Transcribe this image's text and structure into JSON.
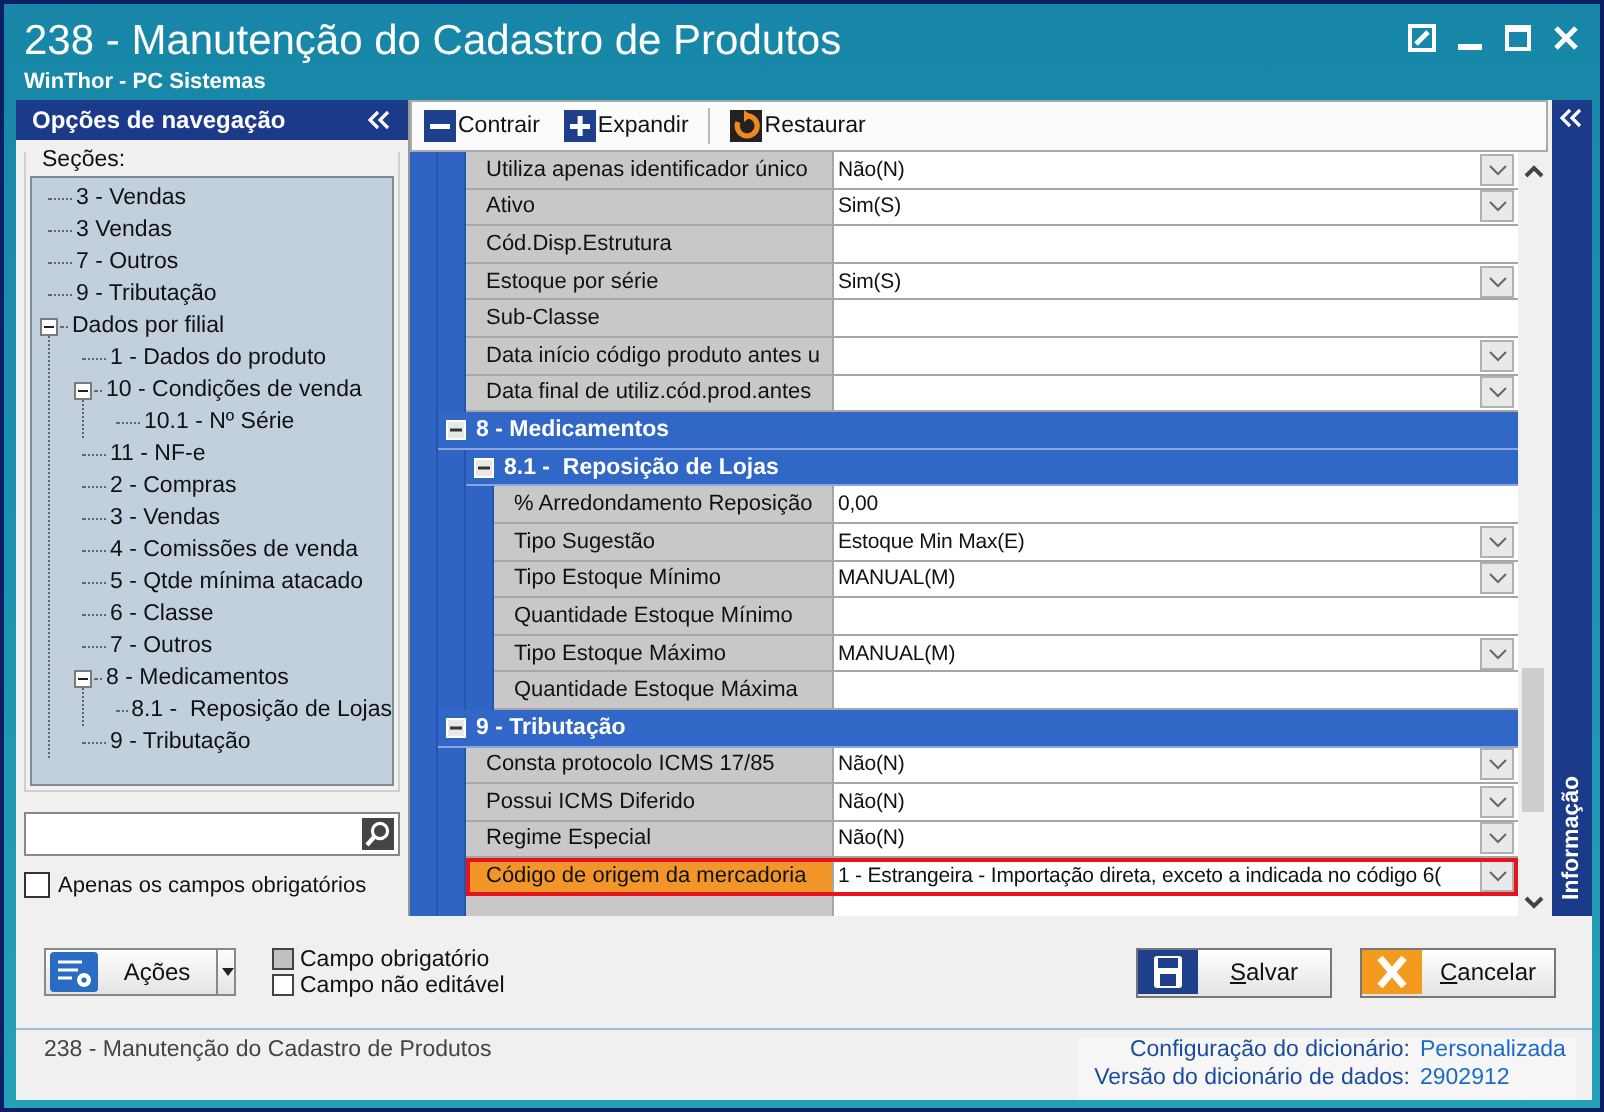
{
  "window": {
    "title": "238 - Manutenção do Cadastro de Produtos",
    "subtitle": "WinThor - PC Sistemas"
  },
  "navigation": {
    "title": "Opções de navegação",
    "sections_label": "Seções:",
    "tree": [
      {
        "label": "3 - Vendas"
      },
      {
        "label": "3 Vendas"
      },
      {
        "label": "7 - Outros"
      },
      {
        "label": "9 - Tributação"
      },
      {
        "label": "Dados por filial",
        "expanded": true,
        "children": [
          {
            "label": "1 - Dados do produto"
          },
          {
            "label": "10 - Condições de venda",
            "expanded": true,
            "children": [
              {
                "label": "10.1 - Nº Série"
              }
            ]
          },
          {
            "label": "11 - NF-e"
          },
          {
            "label": "2 - Compras"
          },
          {
            "label": "3 - Vendas"
          },
          {
            "label": "4 - Comissões de venda"
          },
          {
            "label": "5 - Qtde mínima atacado"
          },
          {
            "label": "6 - Classe"
          },
          {
            "label": "7 - Outros"
          },
          {
            "label": "8 - Medicamentos",
            "expanded": true,
            "children": [
              {
                "label": "8.1 -  Reposição de Lojas"
              }
            ]
          },
          {
            "label": "9 - Tributação"
          }
        ]
      }
    ],
    "only_required": {
      "label": "Apenas os campos obrigatórios",
      "checked": false
    }
  },
  "toolbar": [
    {
      "kind": "collapse",
      "label": "Contrair"
    },
    {
      "kind": "expand",
      "label": "Expandir"
    },
    {
      "kind": "restore",
      "label": "Restaurar"
    }
  ],
  "grid": {
    "items": [
      {
        "kind": "group",
        "children": [
          {
            "kind": "property",
            "label": "Utiliza apenas identificador único",
            "value": "Não(N)",
            "dropdown": true,
            "selected": false
          },
          {
            "kind": "property",
            "label": "Ativo",
            "value": "Sim(S)",
            "dropdown": true,
            "selected": false
          },
          {
            "kind": "property",
            "label": "Cód.Disp.Estrutura",
            "dropdown": false,
            "selected": false
          },
          {
            "kind": "property",
            "label": "Estoque por série",
            "value": "Sim(S)",
            "dropdown": true,
            "selected": false
          },
          {
            "kind": "property",
            "label": "Sub-Classe",
            "dropdown": false,
            "selected": false
          },
          {
            "kind": "property",
            "label": "Data início código produto antes u",
            "dropdown": true,
            "selected": false
          },
          {
            "kind": "property",
            "label": "Data final de utiliz.cód.prod.antes",
            "dropdown": true,
            "selected": false
          }
        ]
      },
      {
        "kind": "category",
        "title": "8 - Medicamentos",
        "expanded": true,
        "children": [
          {
            "kind": "category",
            "title": "8.1 -  Reposição de Lojas",
            "expanded": true,
            "children": [
              {
                "kind": "property",
                "label": "% Arredondamento Reposição",
                "value": "0,00",
                "dropdown": false,
                "selected": false
              },
              {
                "kind": "property",
                "label": "Tipo Sugestão",
                "value": "Estoque Min Max(E)",
                "dropdown": true,
                "selected": false
              },
              {
                "kind": "property",
                "label": "Tipo Estoque Mínimo",
                "value": "MANUAL(M)",
                "dropdown": true,
                "selected": false
              },
              {
                "kind": "property",
                "label": "Quantidade Estoque Mínimo",
                "dropdown": false,
                "selected": false
              },
              {
                "kind": "property",
                "label": "Tipo Estoque Máximo",
                "value": "MANUAL(M)",
                "dropdown": true,
                "selected": false
              },
              {
                "kind": "property",
                "label": "Quantidade Estoque Máxima",
                "dropdown": false,
                "selected": false
              }
            ]
          }
        ]
      },
      {
        "kind": "category",
        "title": "9 - Tributação",
        "expanded": true,
        "children": [
          {
            "kind": "property",
            "label": "Consta protocolo ICMS 17/85",
            "value": "Não(N)",
            "dropdown": true,
            "selected": false
          },
          {
            "kind": "property",
            "label": "Possui ICMS Diferido",
            "value": "Não(N)",
            "dropdown": true,
            "selected": false
          },
          {
            "kind": "property",
            "label": "Regime Especial",
            "value": "Não(N)",
            "dropdown": true,
            "selected": false
          },
          {
            "kind": "property",
            "label": "Código de origem da mercadoria",
            "value": "1 - Estrangeira - Importação direta, exceto a indicada no código 6(",
            "dropdown": true,
            "selected": true
          },
          {
            "kind": "property",
            "dropdown": false,
            "selected": false
          }
        ]
      }
    ]
  },
  "info_panel": {
    "title": "Informação"
  },
  "actions_button": {
    "label": "Ações"
  },
  "legend": [
    {
      "kind": "required",
      "label": "Campo obrigatório"
    },
    {
      "kind": "readonly",
      "label": "Campo não editável"
    }
  ],
  "buttons": [
    {
      "kind": "save",
      "label": "Salvar"
    },
    {
      "kind": "cancel",
      "label": "Cancelar"
    }
  ],
  "status": {
    "text": "238 - Manutenção do Cadastro de Produtos",
    "info": [
      {
        "label": "Configuração do dicionário:",
        "value": "Personalizada"
      },
      {
        "label": "Versão do dicionário de dados:",
        "value": "2902912"
      }
    ]
  }
}
